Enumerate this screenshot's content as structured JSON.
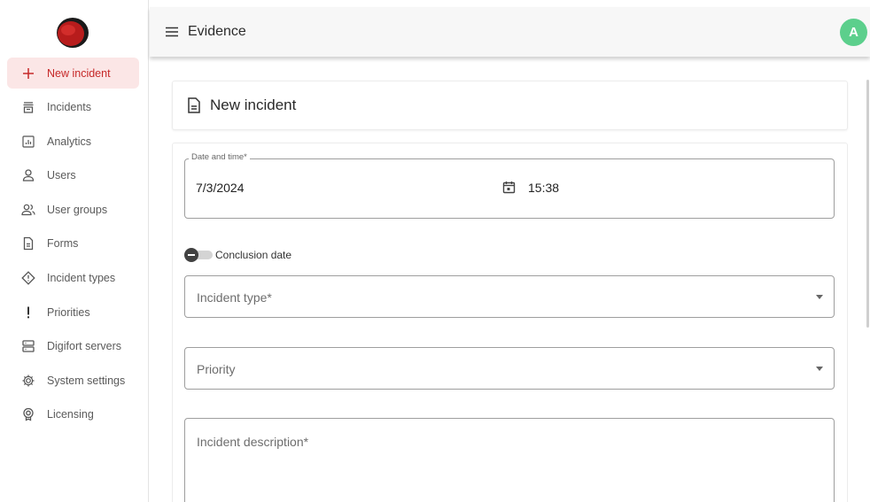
{
  "app": {
    "title": "Evidence",
    "avatar_letter": "A"
  },
  "sidebar": {
    "items": [
      {
        "label": "New incident",
        "icon": "plus-icon",
        "active": true
      },
      {
        "label": "Incidents",
        "icon": "inbox-icon",
        "active": false
      },
      {
        "label": "Analytics",
        "icon": "analytics-icon",
        "active": false
      },
      {
        "label": "Users",
        "icon": "user-icon",
        "active": false
      },
      {
        "label": "User groups",
        "icon": "user-group-icon",
        "active": false
      },
      {
        "label": "Forms",
        "icon": "form-icon",
        "active": false
      },
      {
        "label": "Incident types",
        "icon": "diamond-alert-icon",
        "active": false
      },
      {
        "label": "Priorities",
        "icon": "exclamation-icon",
        "active": false
      },
      {
        "label": "Digifort servers",
        "icon": "server-icon",
        "active": false
      },
      {
        "label": "System settings",
        "icon": "gear-icon",
        "active": false
      },
      {
        "label": "Licensing",
        "icon": "license-icon",
        "active": false
      }
    ]
  },
  "page": {
    "title": "New incident"
  },
  "form": {
    "datetime": {
      "legend": "Date and time*",
      "date": "7/3/2024",
      "time": "15:38"
    },
    "conclusion_toggle": {
      "label": "Conclusion date",
      "on": false
    },
    "incident_type": {
      "placeholder": "Incident type*"
    },
    "priority": {
      "placeholder": "Priority"
    },
    "description": {
      "placeholder": "Incident description*"
    }
  },
  "colors": {
    "accent": "#c62828",
    "active_bg": "#fbe6e6",
    "avatar": "#5ccf8c"
  }
}
